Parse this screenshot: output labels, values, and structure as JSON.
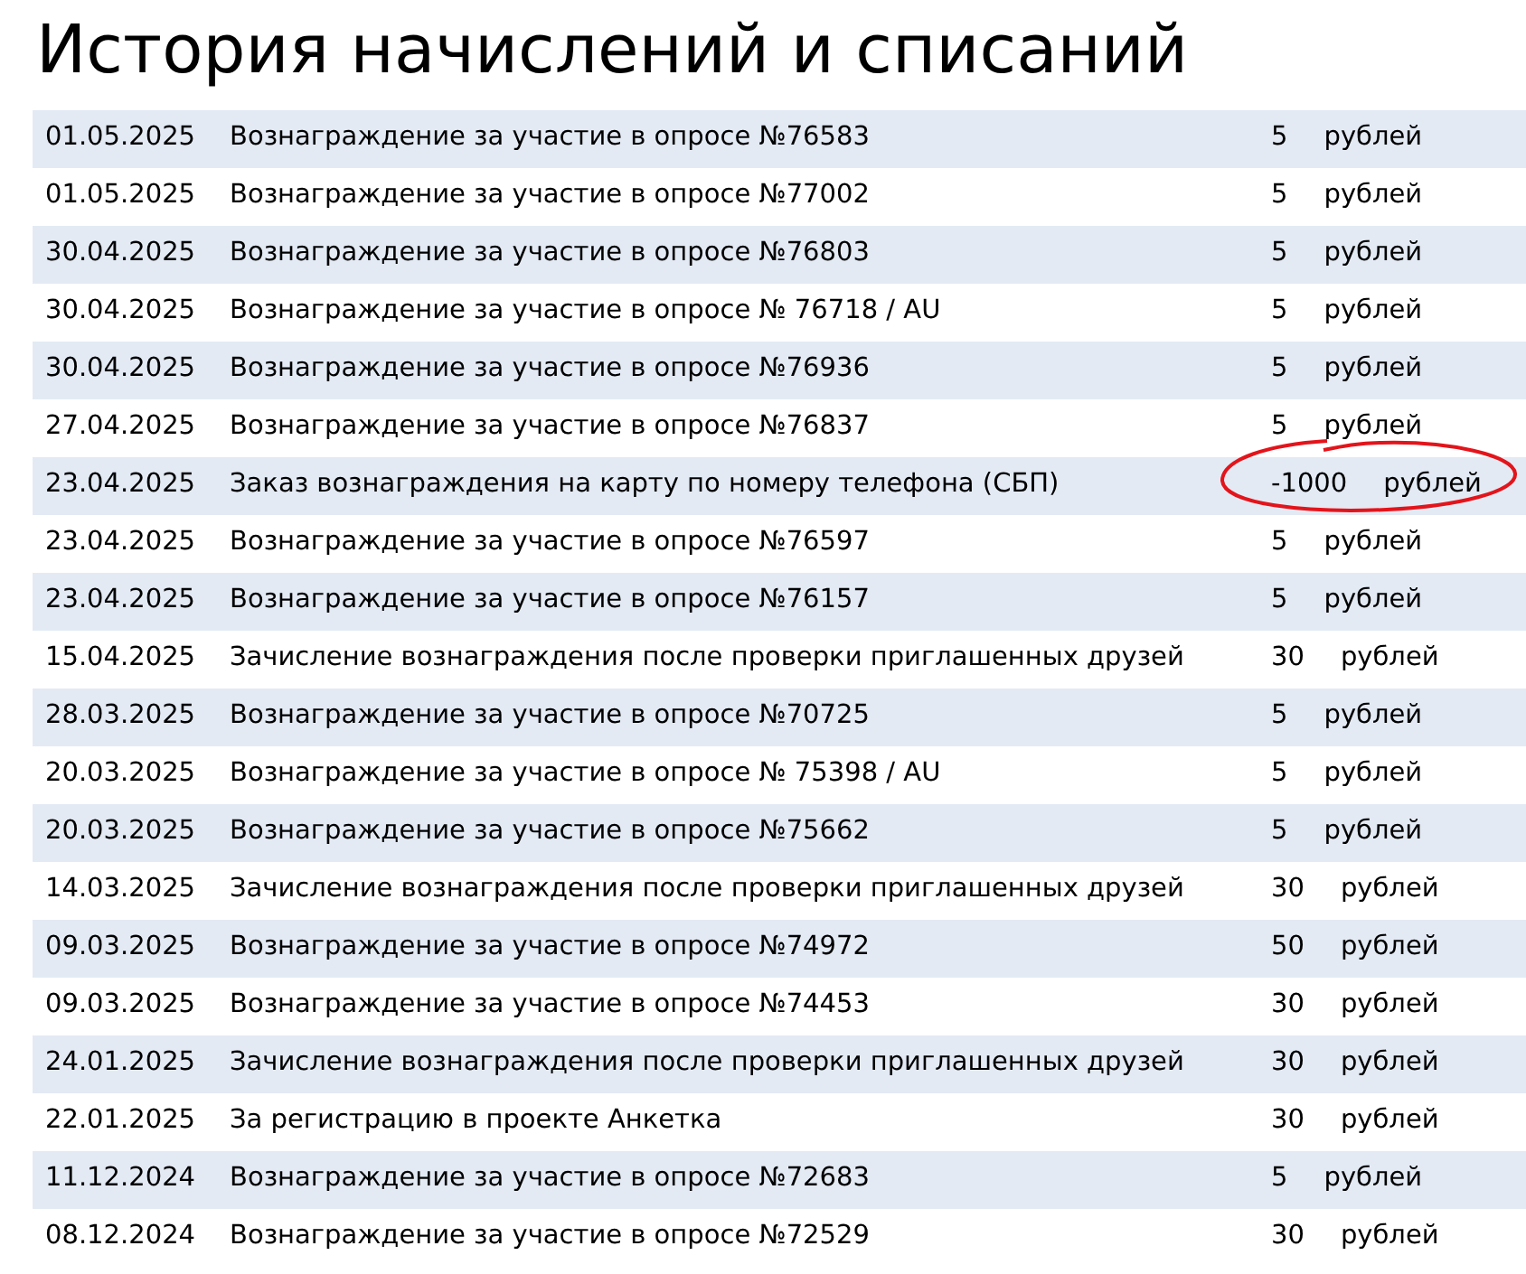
{
  "title": "История начислений и списаний",
  "rows": [
    {
      "date": "01.05.2025",
      "description": "Вознаграждение за участие в опросе №76583",
      "amount": "5",
      "currency": "рублей",
      "circled": false
    },
    {
      "date": "01.05.2025",
      "description": "Вознаграждение за участие в опросе №77002",
      "amount": "5",
      "currency": "рублей",
      "circled": false
    },
    {
      "date": "30.04.2025",
      "description": "Вознаграждение за участие в опросе №76803",
      "amount": "5",
      "currency": "рублей",
      "circled": false
    },
    {
      "date": "30.04.2025",
      "description": "Вознаграждение за участие в опросе № 76718 / AU",
      "amount": "5",
      "currency": "рублей",
      "circled": false
    },
    {
      "date": "30.04.2025",
      "description": "Вознаграждение за участие в опросе №76936",
      "amount": "5",
      "currency": "рублей",
      "circled": false
    },
    {
      "date": "27.04.2025",
      "description": "Вознаграждение за участие в опросе №76837",
      "amount": "5",
      "currency": "рублей",
      "circled": false
    },
    {
      "date": "23.04.2025",
      "description": "Заказ вознаграждения на карту по номеру телефона (СБП)",
      "amount": "-1000",
      "currency": "рублей",
      "circled": true
    },
    {
      "date": "23.04.2025",
      "description": "Вознаграждение за участие в опросе №76597",
      "amount": "5",
      "currency": "рублей",
      "circled": false
    },
    {
      "date": "23.04.2025",
      "description": "Вознаграждение за участие в опросе №76157",
      "amount": "5",
      "currency": "рублей",
      "circled": false
    },
    {
      "date": "15.04.2025",
      "description": "Зачисление вознаграждения после проверки приглашенных друзей",
      "amount": "30",
      "currency": "рублей",
      "circled": false
    },
    {
      "date": "28.03.2025",
      "description": "Вознаграждение за участие в опросе №70725",
      "amount": "5",
      "currency": "рублей",
      "circled": false
    },
    {
      "date": "20.03.2025",
      "description": "Вознаграждение за участие в опросе № 75398 / AU",
      "amount": "5",
      "currency": "рублей",
      "circled": false
    },
    {
      "date": "20.03.2025",
      "description": "Вознаграждение за участие в опросе №75662",
      "amount": "5",
      "currency": "рублей",
      "circled": false
    },
    {
      "date": "14.03.2025",
      "description": "Зачисление вознаграждения после проверки приглашенных друзей",
      "amount": "30",
      "currency": "рублей",
      "circled": false
    },
    {
      "date": "09.03.2025",
      "description": "Вознаграждение за участие в опросе №74972",
      "amount": "50",
      "currency": "рублей",
      "circled": false
    },
    {
      "date": "09.03.2025",
      "description": "Вознаграждение за участие в опросе №74453",
      "amount": "30",
      "currency": "рублей",
      "circled": false
    },
    {
      "date": "24.01.2025",
      "description": "Зачисление вознаграждения после проверки приглашенных друзей",
      "amount": "30",
      "currency": "рублей",
      "circled": false
    },
    {
      "date": "22.01.2025",
      "description": "За регистрацию в проекте Анкетка",
      "amount": "30",
      "currency": "рублей",
      "circled": false
    },
    {
      "date": "11.12.2024",
      "description": "Вознаграждение за участие в опросе №72683",
      "amount": "5",
      "currency": "рублей",
      "circled": false
    },
    {
      "date": "08.12.2024",
      "description": "Вознаграждение за участие в опросе №72529",
      "amount": "30",
      "currency": "рублей",
      "circled": false
    }
  ]
}
